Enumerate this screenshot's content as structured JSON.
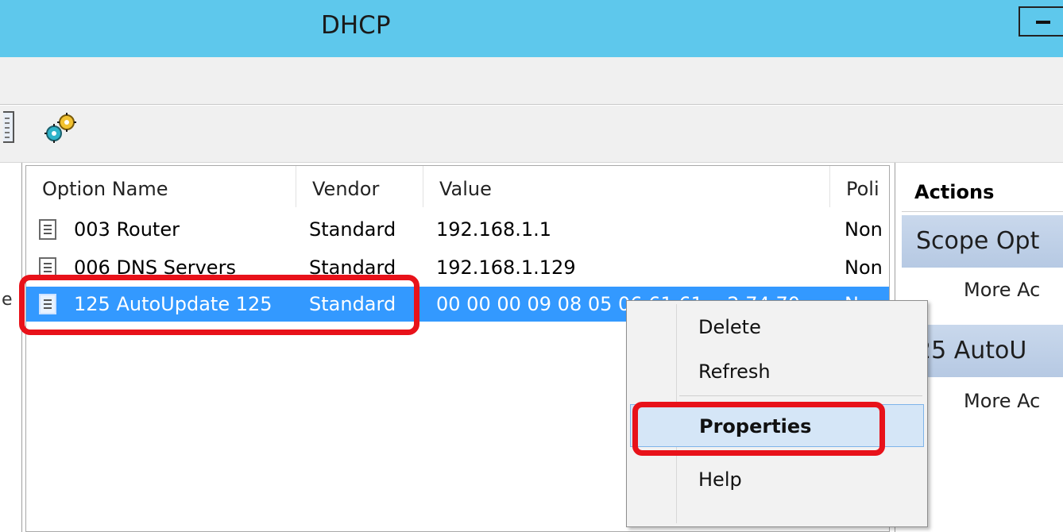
{
  "window": {
    "title": "DHCP"
  },
  "list": {
    "columns": [
      {
        "label": "Option Name"
      },
      {
        "label": "Vendor"
      },
      {
        "label": "Value"
      },
      {
        "label": "Poli"
      }
    ],
    "rows": [
      {
        "name": "003 Router",
        "vendor": "Standard",
        "value": "192.168.1.1",
        "policy": "Non"
      },
      {
        "name": "006 DNS Servers",
        "vendor": "Standard",
        "value": "192.168.1.129",
        "policy": "Non"
      },
      {
        "name": "125 AutoUpdate 125",
        "vendor": "Standard",
        "value": "00 00 00 09 08 05 06 61 61 ...2 74 70",
        "policy": "N",
        "selected": true
      }
    ]
  },
  "actions_pane": {
    "header": "Actions",
    "sections": [
      {
        "title": "Scope Opt",
        "item": "More Ac"
      },
      {
        "title": "25 AutoU",
        "item": "More Ac"
      }
    ]
  },
  "context_menu": {
    "items": [
      {
        "label": "Delete"
      },
      {
        "label": "Refresh"
      },
      {
        "label": "Properties",
        "highlighted": true
      },
      {
        "label": "Help"
      }
    ]
  },
  "left_pane": {
    "visible_char": "e"
  },
  "colors": {
    "titlebar": "#5ec8ec",
    "selection": "#3399ff",
    "highlight_outline": "#e8121a",
    "menu_hover": "#d5e6f7"
  },
  "icons": {
    "toolbar": [
      "list-view-icon",
      "options-gear-icon"
    ],
    "row": "option-document-icon"
  }
}
